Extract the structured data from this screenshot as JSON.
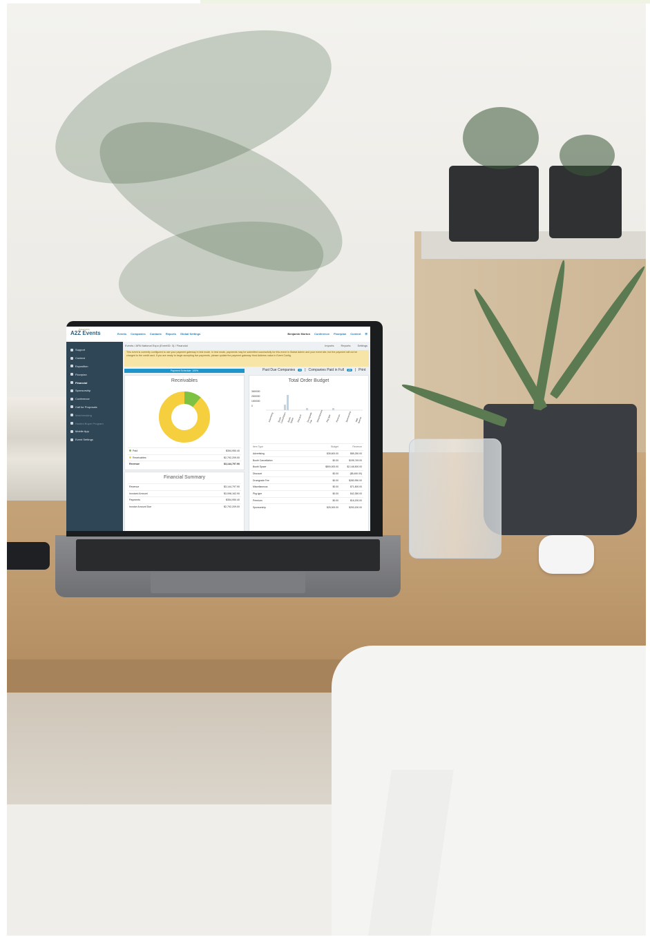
{
  "app": {
    "logo_sub": "Powered by",
    "logo": "A2Z Events",
    "nav": [
      "Events",
      "Companies",
      "Contacts",
      "Reports",
      "Global Settings"
    ],
    "user": "Benjamin Morton",
    "nav_right": [
      "Conference",
      "Floorplan",
      "Content"
    ]
  },
  "sidebar": {
    "items": [
      {
        "label": "Support",
        "state": "normal"
      },
      {
        "label": "Content",
        "state": "normal"
      },
      {
        "label": "Exposition",
        "state": "normal"
      },
      {
        "label": "Floorplan",
        "state": "normal"
      },
      {
        "label": "Financial",
        "state": "active"
      },
      {
        "label": "Sponsorship",
        "state": "normal"
      },
      {
        "label": "Conference",
        "state": "normal"
      },
      {
        "label": "Call for Proposals",
        "state": "normal"
      },
      {
        "label": "Matchmaking",
        "state": "muted"
      },
      {
        "label": "Hosted Buyer Program",
        "state": "muted"
      },
      {
        "label": "Mobile App",
        "state": "normal"
      },
      {
        "label": "Event Settings",
        "state": "normal"
      }
    ]
  },
  "breadcrumb": "Events  /  APA National Expo (EventID: 3)  /  Financial",
  "header_links": [
    "Imports",
    "Reports",
    "Settings"
  ],
  "alert": "This event is currently configured to use your payment gateway in test mode. In test mode, payments may be submitted successfully for this event in Global Admin and your event site, but the payment will not be charged to the credit card. If you are ready to begin accepting live payments, please update the payment gateway Host Address value in Event Config.",
  "payment_bar": "Payment Schedule: 100%",
  "status_links": {
    "past_due": "Past Due Companies",
    "past_due_count": "4",
    "paid_full": "Companies Paid in Full",
    "paid_full_count": "20",
    "print": "Print"
  },
  "receivables": {
    "title": "Receivables",
    "rows": [
      {
        "label": "Paid",
        "value": "$354,950.40",
        "color": "#7dc242"
      },
      {
        "label": "Receivables",
        "value": "$2,792,209.00",
        "color": "#f5cf3d"
      },
      {
        "label": "Revenue",
        "value": "$3,144,797.90",
        "color": ""
      }
    ],
    "paid_fraction": 0.11
  },
  "financial_summary": {
    "title": "Financial Summary",
    "rows": [
      {
        "label": "Revenue",
        "value": "$3,144,797.90"
      },
      {
        "label": "Invoiced Amount",
        "value": "$3,098,162.90"
      },
      {
        "label": "Payments",
        "value": "$354,950.40"
      },
      {
        "label": "Invoice Amount Due",
        "value": "$2,792,209.00"
      }
    ]
  },
  "order_budget": {
    "title": "Total Order Budget",
    "yticks": [
      "3000000",
      "2000000",
      "1000000",
      "0"
    ],
    "categories": [
      "Advertising",
      "Booth Cancellation",
      "Booth Space",
      "Discount",
      "Drumgrade Fee",
      "Miscellaneous",
      "Pkg type",
      "Premium",
      "Sponsorship",
      "Web Banner"
    ],
    "table_head": [
      "Item Type",
      "Budget",
      "Revenue"
    ],
    "rows": [
      {
        "item": "Advertising",
        "budget": "$35,600.00",
        "revenue": "$85,250.00"
      },
      {
        "item": "Booth Cancellation",
        "budget": "$0.00",
        "revenue": "$195,749.00"
      },
      {
        "item": "Booth Space",
        "budget": "$800,000.00",
        "revenue": "$2,146,500.00"
      },
      {
        "item": "Discount",
        "budget": "$0.00",
        "revenue": "($8,450.00)"
      },
      {
        "item": "Drumgrade Fee",
        "budget": "$0.00",
        "revenue": "$280,990.00"
      },
      {
        "item": "Miscellaneous",
        "budget": "$0.00",
        "revenue": "$71,800.00"
      },
      {
        "item": "Pkg type",
        "budget": "$0.00",
        "revenue": "$42,350.00"
      },
      {
        "item": "Premium",
        "budget": "$0.00",
        "revenue": "$16,200.00"
      },
      {
        "item": "Sponsorship",
        "budget": "$25,000.00",
        "revenue": "$253,200.00"
      }
    ]
  }
}
